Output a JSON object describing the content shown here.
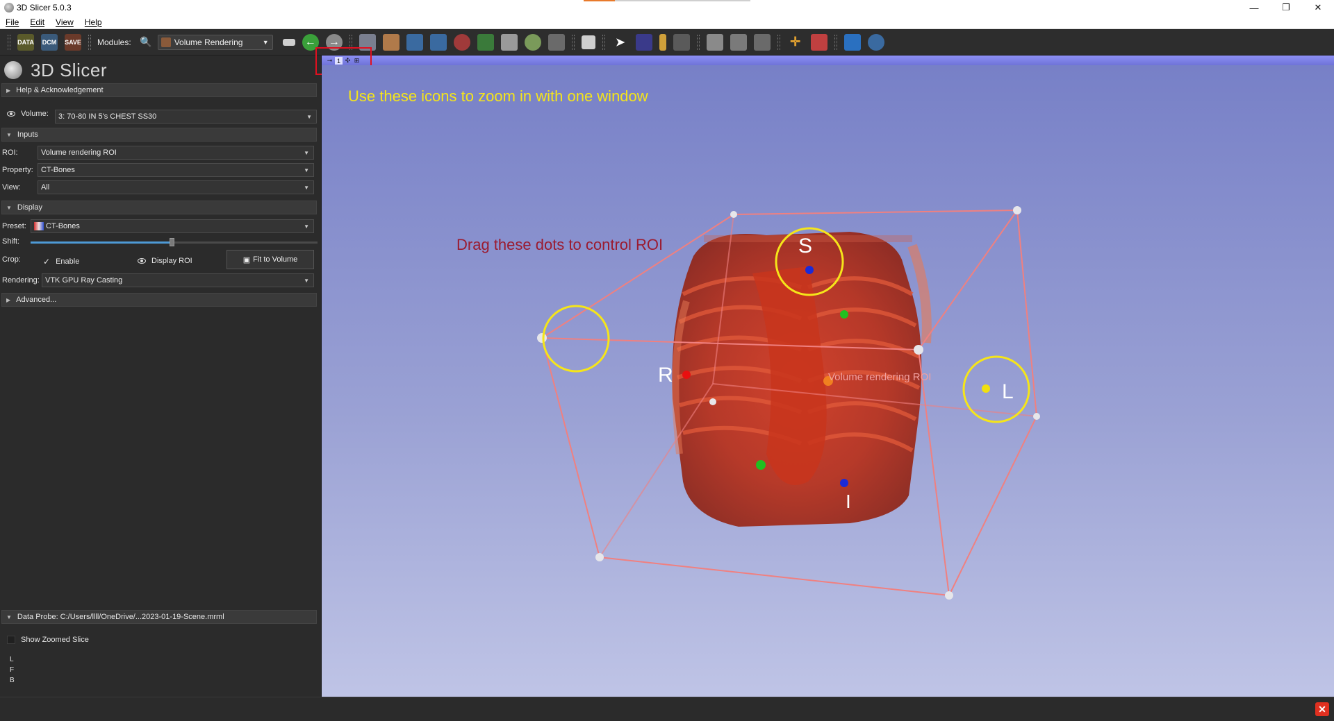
{
  "window": {
    "title": "3D Slicer 5.0.3"
  },
  "menu": [
    {
      "label": "File"
    },
    {
      "label": "Edit"
    },
    {
      "label": "View"
    },
    {
      "label": "Help"
    }
  ],
  "toolbar": {
    "data_label": "DATA",
    "dcm_label": "DCM",
    "save_label": "SAVE",
    "modules_label": "Modules:",
    "module_selected": "Volume Rendering"
  },
  "brand": {
    "name": "3D Slicer"
  },
  "panel": {
    "help_section": "Help & Acknowledgement",
    "volume_label": "Volume:",
    "volume_value": "3: 70-80 IN 5's  CHEST SS30",
    "inputs_section": "Inputs",
    "roi_label": "ROI:",
    "roi_value": "Volume rendering ROI",
    "property_label": "Property:",
    "property_value": "CT-Bones",
    "view_label": "View:",
    "view_value": "All",
    "display_section": "Display",
    "preset_label": "Preset:",
    "preset_value": "CT-Bones",
    "shift_label": "Shift:",
    "shift_fraction": 0.5,
    "crop_label": "Crop:",
    "enable_label": "Enable",
    "display_roi_label": "Display ROI",
    "fit_button": "Fit to Volume",
    "rendering_label": "Rendering:",
    "rendering_value": "VTK GPU Ray Casting",
    "advanced_section": "Advanced...",
    "data_probe_section": "Data Probe: C:/Users/llll/OneDrive/...2023-01-19-Scene.mrml",
    "show_zoomed_slice": "Show Zoomed Slice",
    "probe_letters": [
      "L",
      "F",
      "B"
    ]
  },
  "viewbar": {
    "pin": "⊸",
    "number": "1"
  },
  "view3d": {
    "annotation_zoom": "Use these icons to zoom in with one window",
    "annotation_roi": "Drag these dots to control ROI",
    "roi_label": "Volume rendering ROI",
    "orient_S": "S",
    "orient_R": "R",
    "orient_L": "L",
    "orient_I": "I",
    "annotation_color": "#f5e51a",
    "annotation2_color": "#9b1b30",
    "roi_color": "#f08080"
  }
}
